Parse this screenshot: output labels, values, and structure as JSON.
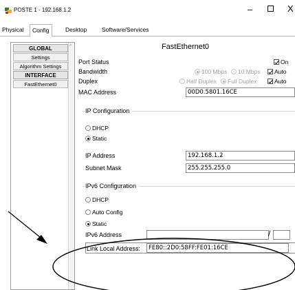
{
  "window": {
    "title": "POSTE 1 - 192.168.1.2",
    "minimize_symbol": "–",
    "close_symbol": "X"
  },
  "tabs": [
    "Physical",
    "Config",
    "Desktop",
    "Software/Services"
  ],
  "active_tab": "Config",
  "sidebar": {
    "items": [
      {
        "label": "GLOBAL",
        "type": "header"
      },
      {
        "label": "Settings",
        "type": "item"
      },
      {
        "label": "Algorithm Settings",
        "type": "item"
      },
      {
        "label": "INTERFACE",
        "type": "header"
      },
      {
        "label": "FastEthernet0",
        "type": "item"
      }
    ]
  },
  "interface": {
    "title": "FastEthernet0",
    "port_status": {
      "label": "Port Status",
      "on_label": "On",
      "on_checked": true
    },
    "bandwidth": {
      "label": "Bandwidth",
      "opt_100": "100 Mbps",
      "opt_10": "10 Mbps",
      "auto_label": "Auto",
      "auto_checked": true
    },
    "duplex": {
      "label": "Duplex",
      "half": "Half Duplex",
      "full": "Full Duplex",
      "auto_label": "Auto",
      "auto_checked": true
    },
    "mac": {
      "label": "MAC Address",
      "value": "00D0.5801.16CE"
    }
  },
  "ip_config": {
    "title": "IP Configuration",
    "dhcp_label": "DHCP",
    "static_label": "Static",
    "selected": "Static",
    "ip_label": "IP Address",
    "ip_value": "192.168.1.2",
    "mask_label": "Subnet Mask",
    "mask_value": "255.255.255.0"
  },
  "ipv6_config": {
    "title": "IPv6 Configuration",
    "dhcp_label": "DHCP",
    "auto_label": "Auto Config",
    "static_label": "Static",
    "selected": "Static",
    "address_label": "IPv6 Address",
    "address_value": "",
    "prefix_value": "",
    "separator": "/",
    "link_local_label": "Link Local Address:",
    "link_local_value": "FE80::2D0:58FF:FE01:16CE"
  },
  "colors": {
    "annotation": "#000000",
    "border": "#8a8a8a",
    "disabled_text": "#a0a0a0"
  }
}
